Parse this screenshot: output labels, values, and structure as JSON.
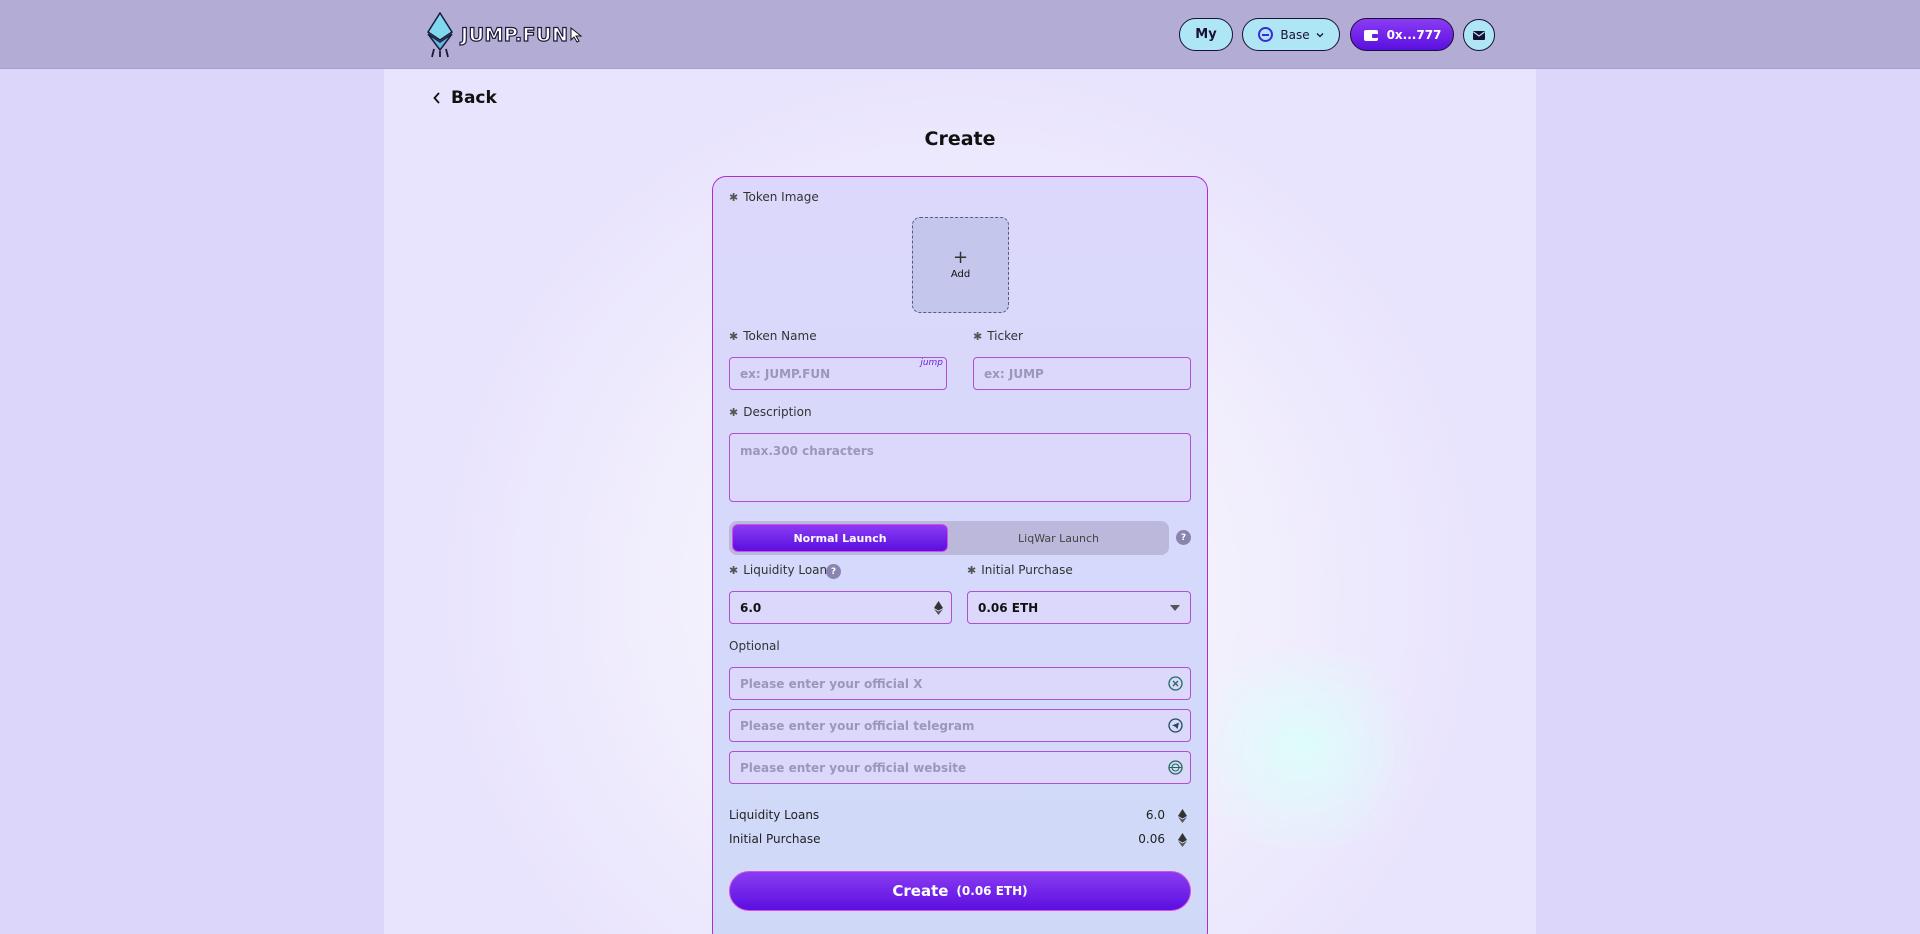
{
  "header": {
    "logo_text": "JUMP.FUN",
    "my_label": "My",
    "chain_label": "Base",
    "wallet_label": "0x...777"
  },
  "page": {
    "back_label": "Back",
    "title": "Create"
  },
  "form": {
    "token_image_label": "Token Image",
    "add_label": "Add",
    "token_name_label": "Token Name",
    "token_name_placeholder": "ex: JUMP.FUN",
    "token_name_tag": "jump",
    "ticker_label": "Ticker",
    "ticker_placeholder": "ex: JUMP",
    "description_label": "Description",
    "description_placeholder": "max.300 characters",
    "launch_normal": "Normal Launch",
    "launch_liqwar": "LiqWar Launch",
    "liquidity_loans_label": "Liquidity Loans",
    "liquidity_loans_value": "6.0",
    "initial_purchase_label": "Initial Purchase",
    "initial_purchase_value": "0.06 ETH",
    "optional_label": "Optional",
    "x_placeholder": "Please enter your official X",
    "telegram_placeholder": "Please enter your official telegram",
    "website_placeholder": "Please enter your official website",
    "help_mark": "?"
  },
  "summary": {
    "liquidity_loans_label": "Liquidity Loans",
    "liquidity_loans_value": "6.0",
    "initial_purchase_label": "Initial Purchase",
    "initial_purchase_value": "0.06"
  },
  "create_button": {
    "label": "Create",
    "sub": "(0.06 ETH)"
  },
  "icons": [
    "jump-logo-icon",
    "cursor-icon",
    "chevron-down-icon",
    "wallet-icon",
    "mail-icon",
    "chevron-left-icon",
    "plus-icon",
    "eth-icon",
    "x-icon",
    "telegram-icon",
    "globe-icon",
    "help-icon"
  ],
  "colors": {
    "accent": "#5b0fe0",
    "header_bg": "#b3acd4",
    "button_light": "#aee6f5",
    "border_accent": "#b02bd1"
  }
}
